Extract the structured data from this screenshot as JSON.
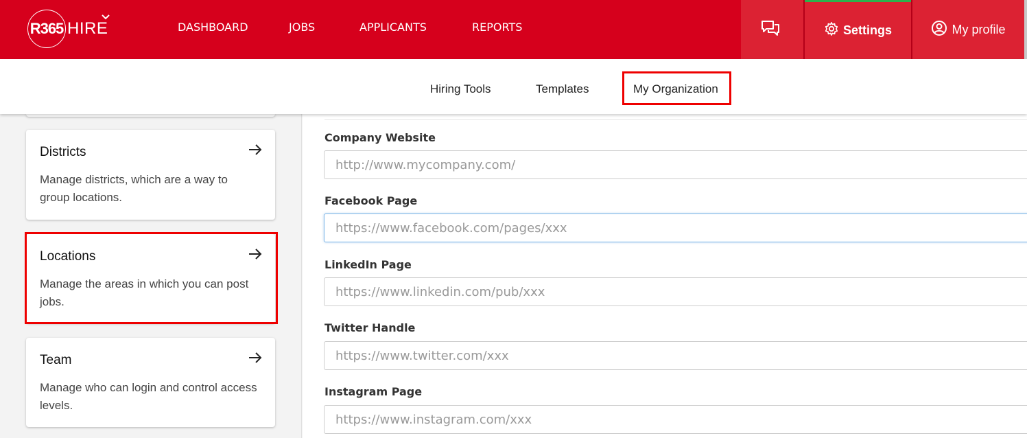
{
  "brand": {
    "logo_mark": "R365",
    "logo_word": "HIRE"
  },
  "topnav": {
    "links": [
      "DASHBOARD",
      "JOBS",
      "APPLICANTS",
      "REPORTS"
    ],
    "settings_label": "Settings",
    "profile_label": "My profile",
    "colors": {
      "bar": "#d6001c",
      "active_indicator": "#2bb24c"
    }
  },
  "subnav": {
    "items": [
      "Hiring Tools",
      "Templates",
      "My Organization"
    ],
    "active": "My Organization"
  },
  "sidebar": {
    "cards": [
      {
        "title": "Districts",
        "description": "Manage districts, which are a way to group locations."
      },
      {
        "title": "Locations",
        "description": "Manage the areas in which you can post jobs."
      },
      {
        "title": "Team",
        "description": "Manage who can login and control access levels."
      }
    ]
  },
  "form": {
    "fields": [
      {
        "label": "Company Website",
        "placeholder": "http://www.mycompany.com/"
      },
      {
        "label": "Facebook Page",
        "placeholder": "https://www.facebook.com/pages/xxx"
      },
      {
        "label": "LinkedIn Page",
        "placeholder": "https://www.linkedin.com/pub/xxx"
      },
      {
        "label": "Twitter Handle",
        "placeholder": "https://www.twitter.com/xxx"
      },
      {
        "label": "Instagram Page",
        "placeholder": "https://www.instagram.com/xxx"
      }
    ]
  }
}
